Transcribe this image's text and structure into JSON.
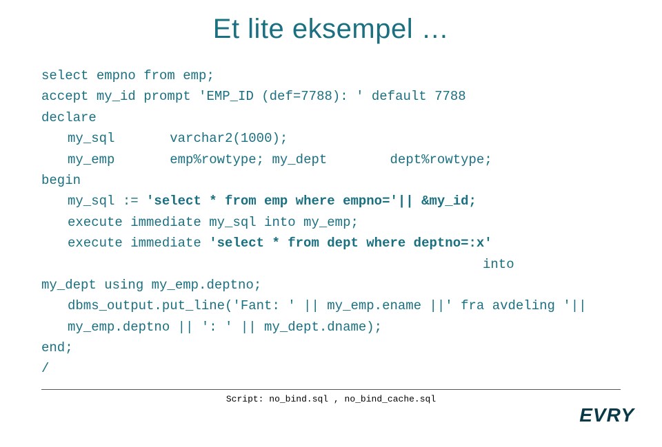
{
  "title": "Et lite eksempel …",
  "code": {
    "l1": "select empno from emp;",
    "l2": "accept my_id prompt 'EMP_ID (def=7788): ' default 7788",
    "l3": "declare",
    "l4a": "my_sql",
    "l4b": "varchar2(1000);",
    "l5a": "my_emp",
    "l5b": "emp%rowtype; my_dept",
    "l5c": "dept%rowtype;",
    "l6": "begin",
    "l7a": "my_sql := ",
    "l7b": "'select * from emp where empno='|| &my_id;",
    "l8": "execute immediate my_sql into my_emp;",
    "l9a": "execute immediate ",
    "l9b": "'select * from dept where deptno=:x'",
    "l10": "into",
    "l11": "my_dept using my_emp.deptno;",
    "l12": "dbms_output.put_line('Fant: ' || my_emp.ename ||' fra avdeling '||  my_emp.deptno || ': ' || my_dept.dname);",
    "l13": "end;",
    "l14": "/"
  },
  "script": {
    "label": "Script: ",
    "file1": "no_bind.sql",
    "sep": " , ",
    "file2": "no_bind_cache.sql"
  },
  "logo": "EVRY"
}
